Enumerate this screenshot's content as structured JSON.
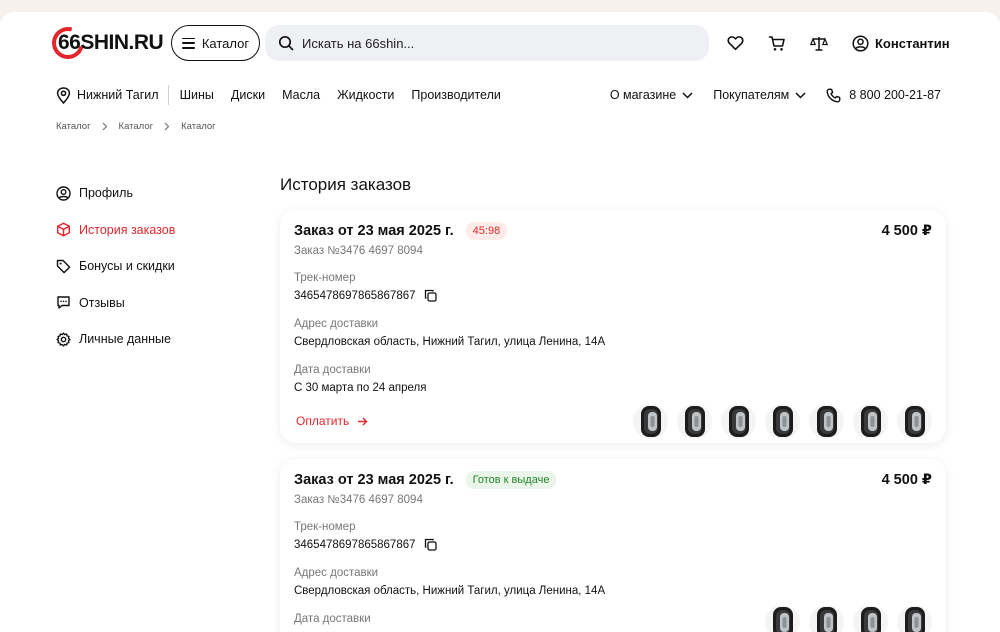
{
  "header": {
    "logo_text": "66SHIN.RU",
    "catalog_label": "Каталог",
    "search_placeholder": "Искать на 66shin...",
    "user_name": "Константин"
  },
  "nav": {
    "city": "Нижний Тагил",
    "links": [
      "Шины",
      "Диски",
      "Масла",
      "Жидкости",
      "Производители"
    ],
    "about_label": "О магазине",
    "buyers_label": "Покупателям",
    "phone": "8 800 200-21-87"
  },
  "breadcrumbs": [
    "Каталог",
    "Каталог",
    "Каталог"
  ],
  "sidebar": {
    "items": [
      {
        "label": "Профиль",
        "icon": "user-icon",
        "active": false
      },
      {
        "label": "История заказов",
        "icon": "box-icon",
        "active": true
      },
      {
        "label": "Бонусы и скидки",
        "icon": "tag-icon",
        "active": false
      },
      {
        "label": "Отзывы",
        "icon": "chat-icon",
        "active": false
      },
      {
        "label": "Личные данные",
        "icon": "gear-icon",
        "active": false
      }
    ]
  },
  "main": {
    "title": "История заказов",
    "orders": [
      {
        "title": "Заказ от 23 мая 2025 г.",
        "badge": "45:98",
        "badge_type": "timer",
        "number": "Заказ №3476 4697 8094",
        "price": "4 500 ₽",
        "track_label": "Трек-номер",
        "track": "3465478697865867867",
        "address_label": "Адрес доставки",
        "address": "Свердловская область, Нижний Тагил, улица Ленина, 14А",
        "date_label": "Дата доставки",
        "date": "С 30 марта по 24 апреля",
        "pay_label": "Оплатить"
      },
      {
        "title": "Заказ от 23 мая 2025 г.",
        "badge": "Готов к выдаче",
        "badge_type": "ready",
        "number": "Заказ №3476 4697 8094",
        "price": "4 500 ₽",
        "track_label": "Трек-номер",
        "track": "3465478697865867867",
        "address_label": "Адрес доставки",
        "address": "Свердловская область, Нижний Тагил, улица Ленина, 14А",
        "date_label": "Дата доставки"
      }
    ]
  },
  "colors": {
    "accent": "#e3262b",
    "ready": "#24852e",
    "search_bg": "#eff0f3"
  }
}
